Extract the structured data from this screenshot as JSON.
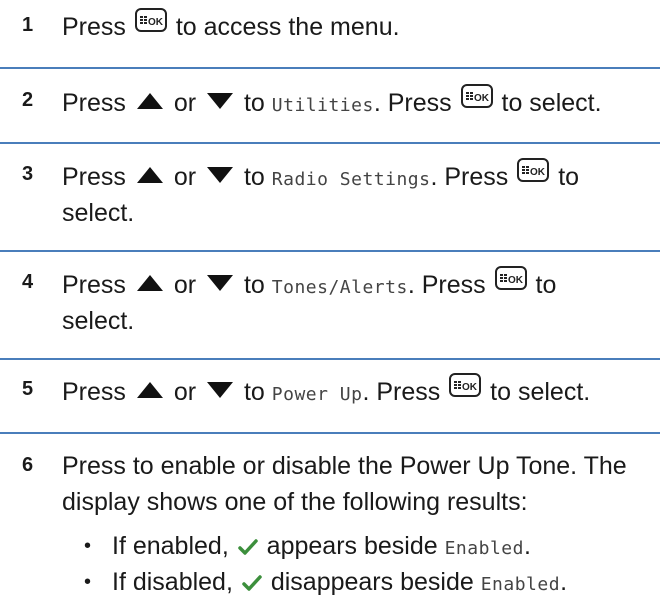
{
  "steps": [
    {
      "num": "1",
      "parts": [
        "Press",
        "to access the menu."
      ]
    },
    {
      "num": "2",
      "parts": [
        "Press",
        "or",
        "to",
        "Utilities",
        ". Press",
        "to select."
      ]
    },
    {
      "num": "3",
      "parts": [
        "Press",
        "or",
        "to",
        "Radio Settings",
        ". Press",
        "to",
        "select."
      ]
    },
    {
      "num": "4",
      "parts": [
        "Press",
        "or",
        "to",
        "Tones/Alerts",
        ". Press",
        "to",
        "select."
      ]
    },
    {
      "num": "5",
      "parts": [
        "Press",
        "or",
        "to",
        "Power Up",
        ". Press",
        "to select."
      ]
    },
    {
      "num": "6",
      "lines": [
        "Press to enable or disable the Power Up Tone. The",
        "display shows one of the following results:"
      ]
    }
  ],
  "bullets": [
    {
      "dot": "•",
      "pre": "If enabled,",
      "mid": "appears beside",
      "mono": "Enabled",
      "post": "."
    },
    {
      "dot": "•",
      "pre": "If disabled,",
      "mid": "disappears beside",
      "mono": "Enabled",
      "post": "."
    }
  ],
  "icons": {
    "ok_key": "menu-ok-key-icon",
    "up": "up-arrow-icon",
    "down": "down-arrow-icon",
    "check": "checkmark-icon"
  },
  "colors": {
    "separator": "#4a7ebb",
    "check": "#3c8f3c"
  }
}
